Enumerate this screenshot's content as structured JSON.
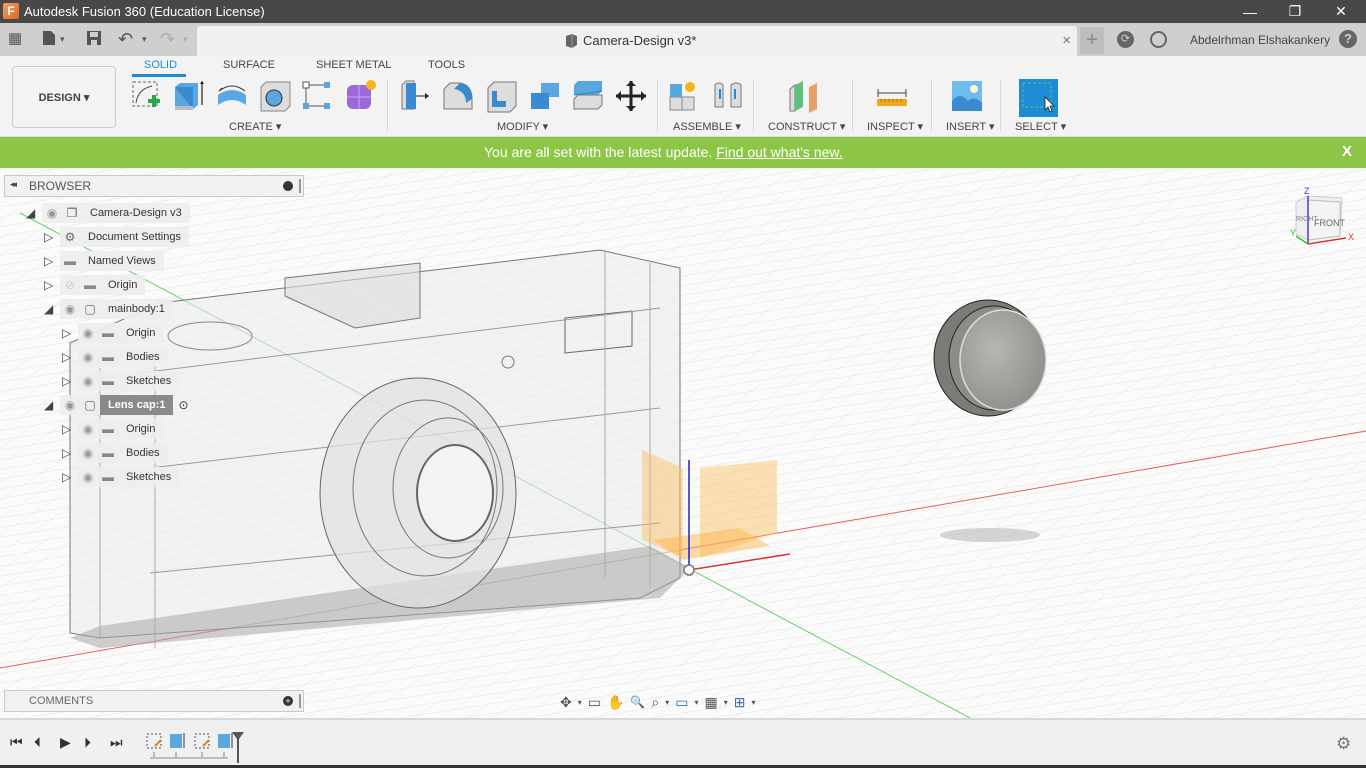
{
  "window": {
    "app_title": "Autodesk Fusion 360 (Education License)",
    "logo_letter": "F",
    "minimize": "—",
    "restore": "❐",
    "close": "✕"
  },
  "quick_access": {
    "grid_icon": "▦",
    "file_icon": "▮",
    "save_icon": "💾",
    "undo_icon": "↶",
    "redo_icon": "↷",
    "dropdown": "▾"
  },
  "document_tab": {
    "name": "Camera-Design v3*",
    "close": "×",
    "new_tab": "+"
  },
  "header_right": {
    "extensions_icon": "⟳",
    "job_status_icon": "◷",
    "user_name": "Abdelrhman Elshakankery",
    "help_icon": "?"
  },
  "ribbon": {
    "workspace": "DESIGN ▾",
    "tabs": [
      {
        "label": "SOLID",
        "active": true
      },
      {
        "label": "SURFACE",
        "active": false
      },
      {
        "label": "SHEET METAL",
        "active": false
      },
      {
        "label": "TOOLS",
        "active": false
      }
    ],
    "groups": [
      {
        "label": "CREATE ▾",
        "tools": [
          "create-sketch",
          "extrude",
          "revolve",
          "hole",
          "pattern",
          "create-form"
        ]
      },
      {
        "label": "MODIFY ▾",
        "tools": [
          "press-pull",
          "fillet",
          "shell",
          "combine",
          "split-body",
          "move-copy"
        ]
      },
      {
        "label": "ASSEMBLE ▾",
        "tools": [
          "new-component",
          "joint"
        ]
      },
      {
        "label": "CONSTRUCT ▾",
        "tools": [
          "offset-plane"
        ]
      },
      {
        "label": "INSPECT ▾",
        "tools": [
          "measure"
        ]
      },
      {
        "label": "INSERT ▾",
        "tools": [
          "insert-image"
        ]
      },
      {
        "label": "SELECT ▾",
        "tools": [
          "window-select"
        ]
      }
    ]
  },
  "banner": {
    "message": "You are all set with the latest update.",
    "link": "Find out what's new.",
    "close": "X",
    "color": "#8dc646"
  },
  "browser": {
    "title": "BROWSER",
    "collapse_icon": "◂◂",
    "items": [
      {
        "label": "Camera-Design v3",
        "level": 0,
        "expanded": true,
        "icon": "component"
      },
      {
        "label": "Document Settings",
        "level": 1,
        "expanded": false,
        "icon": "gear"
      },
      {
        "label": "Named Views",
        "level": 1,
        "expanded": false,
        "icon": "folder"
      },
      {
        "label": "Origin",
        "level": 1,
        "expanded": false,
        "icon": "folder",
        "hidden": true
      },
      {
        "label": "mainbody:1",
        "level": 1,
        "expanded": true,
        "icon": "body"
      },
      {
        "label": "Origin",
        "level": 2,
        "expanded": false,
        "icon": "folder"
      },
      {
        "label": "Bodies",
        "level": 2,
        "expanded": false,
        "icon": "folder"
      },
      {
        "label": "Sketches",
        "level": 2,
        "expanded": false,
        "icon": "folder"
      },
      {
        "label": "Lens cap:1",
        "level": 1,
        "expanded": true,
        "icon": "body",
        "active": true
      },
      {
        "label": "Origin",
        "level": 2,
        "expanded": false,
        "icon": "folder"
      },
      {
        "label": "Bodies",
        "level": 2,
        "expanded": false,
        "icon": "folder"
      },
      {
        "label": "Sketches",
        "level": 2,
        "expanded": false,
        "icon": "folder"
      }
    ]
  },
  "viewcube": {
    "front": "FRONT",
    "side": "RIGHT",
    "z": "Z",
    "x": "X",
    "y": "Y"
  },
  "comments": {
    "title": "COMMENTS",
    "add_icon": "+"
  },
  "nav_bar": {
    "orbit": "✥",
    "look_at": "▭",
    "pan": "✋",
    "zoom": "🔍",
    "fit": "⌕",
    "display": "▭",
    "grid": "▦",
    "viewports": "⊞"
  },
  "timeline": {
    "first": "⏮",
    "prev": "⏴",
    "play": "▶",
    "next": "⏵",
    "last": "⏭",
    "features": [
      "sketch",
      "extrude",
      "sketch",
      "extrude"
    ],
    "settings_icon": "⚙"
  }
}
